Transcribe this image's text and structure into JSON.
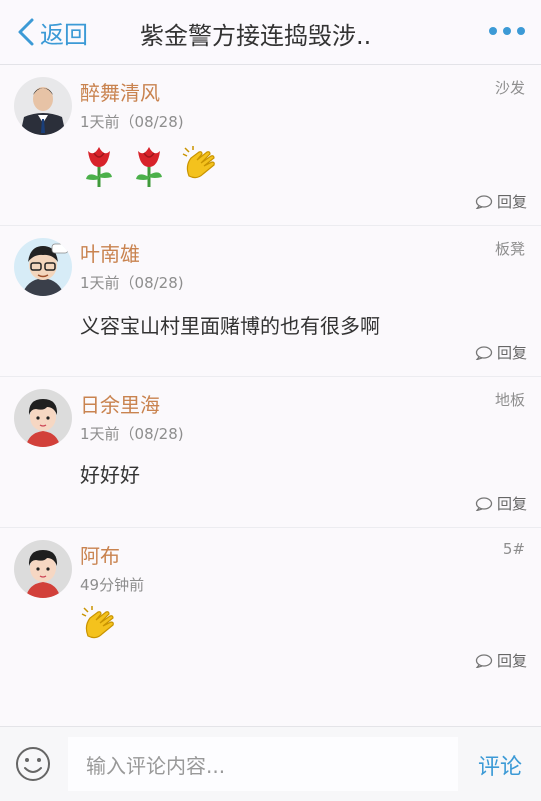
{
  "header": {
    "back_label": "返回",
    "title": "紫金警方接连捣毁涉..",
    "accent_color": "#3c9ad6"
  },
  "comments": [
    {
      "name": "醉舞清风",
      "time": "1天前（08/28)",
      "floor": "沙发",
      "content": "",
      "emojis": [
        "rose-emoji",
        "rose-emoji",
        "clapping-hands-emoji"
      ],
      "reply_label": "回复",
      "avatar": "man-in-suit-avatar"
    },
    {
      "name": "叶南雄",
      "time": "1天前（08/28)",
      "floor": "板凳",
      "content": "义容宝山村里面赌博的也有很多啊",
      "emojis": [],
      "reply_label": "回复",
      "avatar": "cartoon-boy-avatar"
    },
    {
      "name": "日余里海",
      "time": "1天前（08/28)",
      "floor": "地板",
      "content": "好好好",
      "emojis": [],
      "reply_label": "回复",
      "avatar": "default-avatar"
    },
    {
      "name": "阿布",
      "time": "49分钟前",
      "floor": "5#",
      "content": "",
      "emojis": [
        "clapping-hands-emoji"
      ],
      "reply_label": "回复",
      "avatar": "default-avatar"
    }
  ],
  "footer": {
    "input_placeholder": "输入评论内容...",
    "send_label": "评论"
  }
}
